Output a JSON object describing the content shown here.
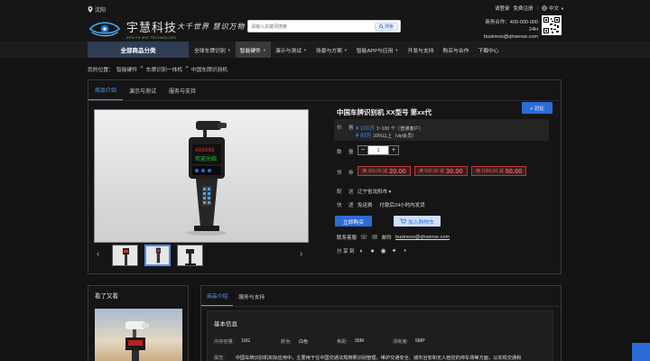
{
  "header": {
    "location": "沈阳",
    "brand": {
      "name": "宇慧科技",
      "sub": "ZENITH WIS TECHNOLOGY",
      "slogan": "大千世界 慧识万物"
    },
    "search": {
      "placeholder": "请输入关键词搜索",
      "button": "搜索"
    },
    "top_links": {
      "login": "请登录",
      "register": "免费注册",
      "language": "中文"
    },
    "hotline": {
      "label": "商务合作：400-000-000 24H",
      "email": "business@qhsense.com"
    }
  },
  "nav": {
    "category_button": "全部商品分类",
    "items": [
      {
        "label": "全球车牌识别",
        "has_caret": true,
        "active": false
      },
      {
        "label": "智能硬件",
        "has_caret": true,
        "active": true
      },
      {
        "label": "演示与测试",
        "has_caret": true,
        "active": false
      },
      {
        "label": "场景与方案",
        "has_caret": true,
        "active": false
      },
      {
        "label": "智能APP与应用",
        "has_caret": true,
        "active": false
      },
      {
        "label": "开发与支持",
        "has_caret": false,
        "active": false
      },
      {
        "label": "购买与合作",
        "has_caret": false,
        "active": false
      },
      {
        "label": "下载中心",
        "has_caret": false,
        "active": false
      }
    ]
  },
  "breadcrumb": {
    "prefix": "您的位置：",
    "items": [
      "智能硬件",
      "车牌识别一体机",
      "中国车牌识别机"
    ],
    "sep": ">"
  },
  "product_tabs": [
    "商品介绍",
    "演示与测试",
    "服务与支持"
  ],
  "product": {
    "title": "中国车牌识别机 XX型号 第xx代",
    "compare": "+ 对比",
    "price_label": "价 格",
    "price1": {
      "value": "¥ 100万",
      "note": "1~100 个（普通客户）"
    },
    "price2": {
      "value": "¥ 80万",
      "note": "10%以上（vip会员）"
    },
    "qty_label": "数 量",
    "qty": "1",
    "coupon_label": "领 券",
    "coupons": [
      {
        "text": "满 300.00 减",
        "amount": "20.00"
      },
      {
        "text": "满 500.00 减",
        "amount": "30.00"
      },
      {
        "text": "满 1000.00 减",
        "amount": "50.00"
      }
    ],
    "ship_label": "配 送",
    "ship": "辽宁省沈阳市 ▾",
    "service_label": "快 递",
    "service": [
      "免运费",
      "付款后24小时内发货"
    ],
    "buy": "立即购买",
    "cart": "加入购物车",
    "contact_label": "联系客服",
    "email_label": "邮件",
    "email": "business@qhsense.com",
    "share_label": "分 享 到"
  },
  "sidebar_seen": {
    "title": "看了又看"
  },
  "detail_tabs": [
    "商品介绍",
    "服务与支持"
  ],
  "basic": {
    "title": "基本信息",
    "specs": [
      {
        "k": "内存容量:",
        "v": "16G"
      },
      {
        "k": "颜色:",
        "v": "白色"
      },
      {
        "k": "焦距:",
        "v": "30M"
      },
      {
        "k": "清晰度:",
        "v": "5MP"
      }
    ],
    "desc_k": "属性:",
    "desc_v": "中国车牌识别机实际应用中，主要用于在中国交通法规牌照识别管理，维护交通安全、城市治安和无人管控的停车场等方面，以实现交通和"
  },
  "colors": {
    "accent": "#2c6cd8",
    "bg": "#131313",
    "coupon": "#c23838"
  }
}
